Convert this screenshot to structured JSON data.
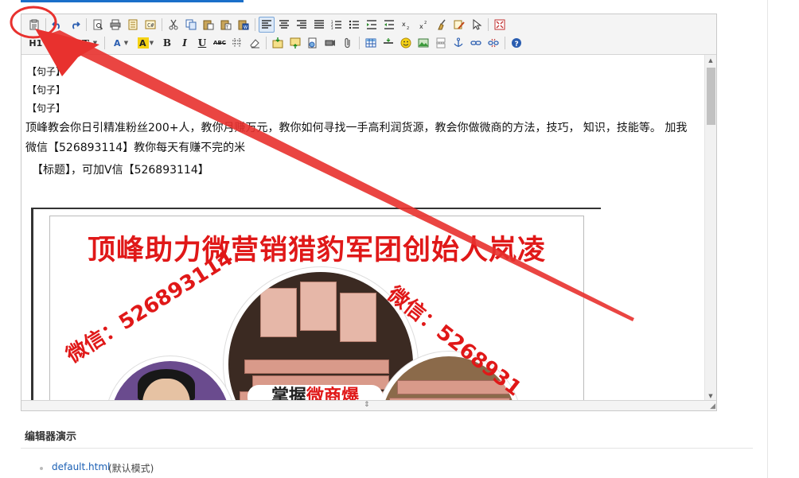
{
  "editor": {
    "toolbar": {
      "heading_label": "H1",
      "font_family_icon": "font-family-icon",
      "font_size_icon": "font-size-icon",
      "bold_label": "B",
      "italic_label": "I",
      "underline_label": "U",
      "strike_label": "ABC"
    },
    "content": {
      "sentence_lines": [
        "【句子】",
        "【句子】",
        "【句子】"
      ],
      "paragraph": "顶峰教会你日引精准粉丝200+人，教你月赚万元，教你如何寻找一手高利润货源，教会你做微商的方法，技巧， 知识，技能等。 加我微信【526893114】教你每天有赚不完的米",
      "title_line": "【标题】，可加V信【526893114】",
      "poster": {
        "headline": "顶峰助力微营销猎豹军团创始人岚凌",
        "wechat_left": "微信：526893114",
        "wechat_right": "微信：5268931",
        "banner_prefix": "掌握",
        "banner_red": "微商爆"
      }
    }
  },
  "section": {
    "title": "编辑器演示",
    "links": [
      {
        "label": "default.html",
        "note": "(默认模式)"
      }
    ]
  },
  "colors": {
    "annotation": "#e8312e",
    "accent_blue": "#1a6fc9",
    "poster_red": "#e01818"
  }
}
